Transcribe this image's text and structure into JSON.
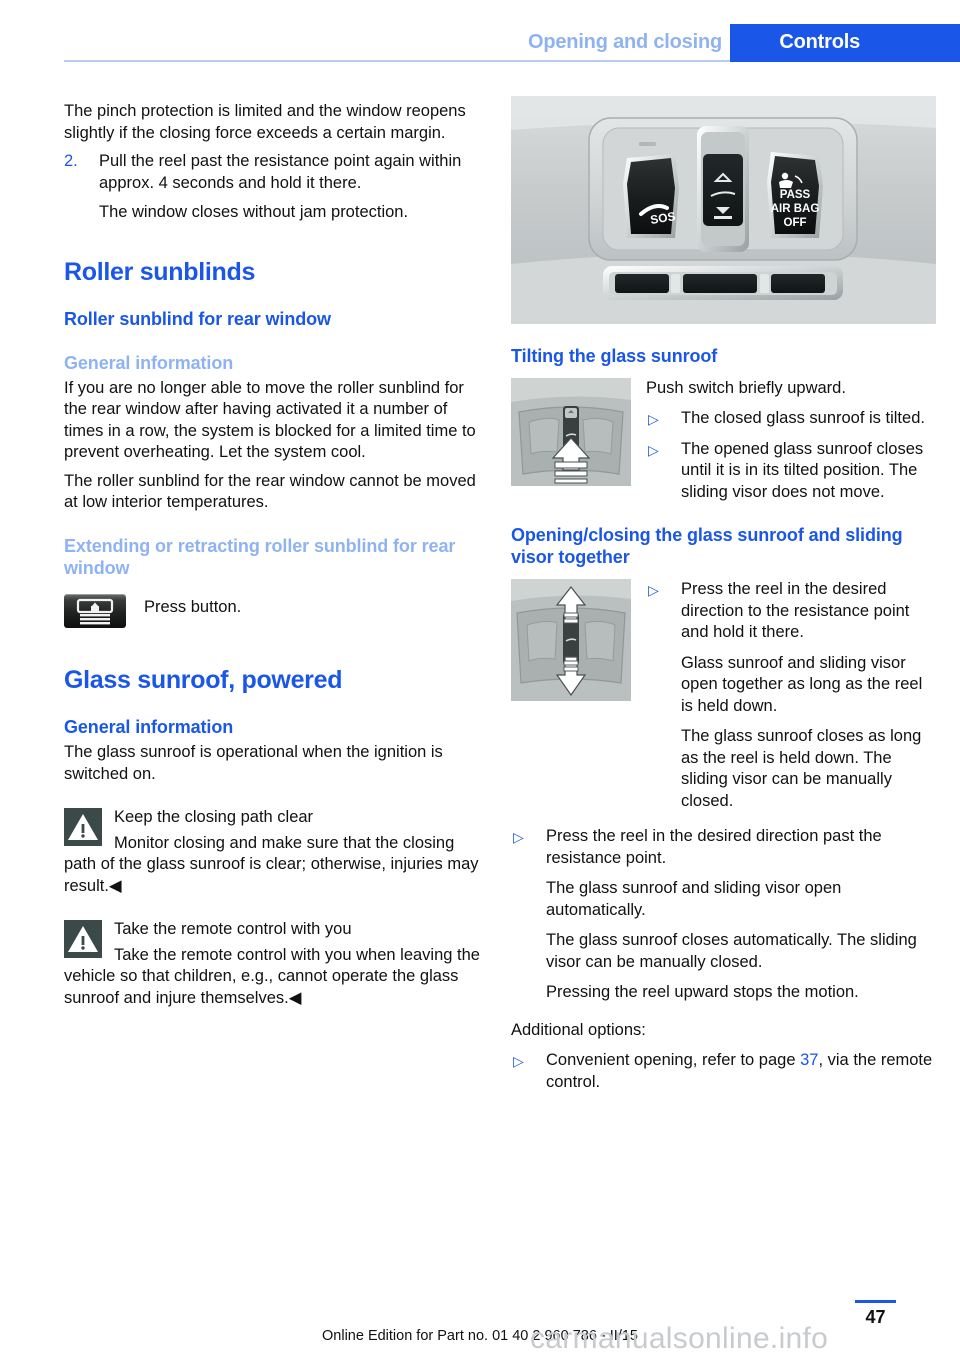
{
  "header": {
    "chapter": "Opening and closing",
    "section": "Controls"
  },
  "left_column": {
    "intro_paragraph": "The pinch protection is limited and the window reopens slightly if the closing force exceeds a certain margin.",
    "step": {
      "number": "2.",
      "text": "Pull the reel past the resistance point again within approx. 4 seconds and hold it there.",
      "result": "The window closes without jam protection."
    },
    "h1_roller_sunblinds": "Roller sunblinds",
    "h2_roller_sunblind_rear": "Roller sunblind for rear window",
    "h3_general_information": "General information",
    "general_info_p1": "If you are no longer able to move the roller sunblind for the rear window after having activated it a number of times in a row, the system is blocked for a limited time to prevent overheating. Let the system cool.",
    "general_info_p2": "The roller sunblind for the rear window cannot be moved at low interior temperatures.",
    "h3_extending_retracting": "Extending or retracting roller sunblind for rear window",
    "press_button_label": "Press button.",
    "h1_glass_sunroof": "Glass sunroof, powered",
    "h2_general_information": "General information",
    "glass_sunroof_p1": "The glass sunroof is operational when the ignition is switched on.",
    "warning_1": {
      "title": "Keep the closing path clear",
      "body": "Monitor closing and make sure that the closing path of the glass sunroof is clear; otherwise, injuries may result.◀"
    },
    "warning_2": {
      "title": "Take the remote control with you",
      "body": "Take the remote control with you when leaving the vehicle so that children, e.g., cannot operate the glass sunroof and injure themselves.◀"
    }
  },
  "right_column": {
    "h2_tilting": "Tilting the glass sunroof",
    "tilting_lead": "Push switch briefly upward.",
    "tilting_bullets": [
      "The closed glass sunroof is tilted.",
      "The opened glass sunroof closes until it is in its tilted position. The sliding visor does not move."
    ],
    "h2_opening_closing": "Opening/closing the glass sunroof and sliding visor together",
    "opening_bullet_1": {
      "text": "Press the reel in the desired direction to the resistance point and hold it there.",
      "note_1": "Glass sunroof and sliding visor open together as long as the reel is held down.",
      "note_2": "The glass sunroof closes as long as the reel is held down. The sliding visor can be manually closed."
    },
    "opening_bullet_2": {
      "text": "Press the reel in the desired direction past the resistance point.",
      "note_1": "The glass sunroof and sliding visor open automatically.",
      "note_2": "The glass sunroof closes automatically. The sliding visor can be manually closed.",
      "note_3": "Pressing the reel upward stops the motion."
    },
    "additional_options_label": "Additional options:",
    "additional_bullet": {
      "prefix": "Convenient opening, refer to page ",
      "page": "37",
      "suffix": ", via the remote control."
    }
  },
  "photo_labels": {
    "sos": "SOS",
    "pass": "PASS",
    "air_bag": "AIR BAG",
    "off": "OFF"
  },
  "footer": {
    "page_number": "47",
    "edition": "Online Edition for Part no. 01 40 2 960 786 - II/15",
    "watermark": "carmanualsonline.info"
  },
  "colors": {
    "accent_blue": "#1a56e8",
    "light_blue": "#8fb3f2",
    "warning_box": "#3b4a49"
  }
}
